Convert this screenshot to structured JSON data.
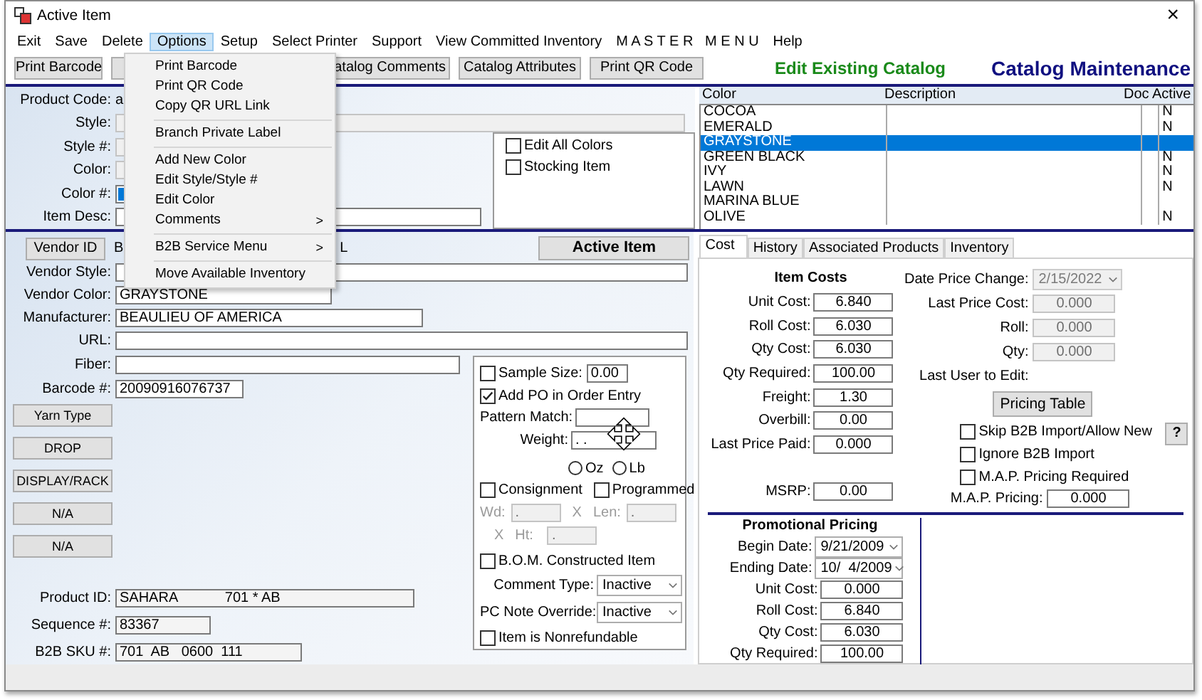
{
  "window": {
    "title": "Active Item",
    "close": "×"
  },
  "menu_bar": [
    {
      "label": "Exit",
      "open": false
    },
    {
      "label": "Save",
      "open": false
    },
    {
      "label": "Delete",
      "open": false
    },
    {
      "label": "Options",
      "open": true
    },
    {
      "label": "Setup",
      "open": false
    },
    {
      "label": "Select Printer",
      "open": false
    },
    {
      "label": "Support",
      "open": false
    },
    {
      "label": "View Committed Inventory",
      "open": false
    },
    {
      "label": "M A S T E R   M E N U",
      "open": false
    },
    {
      "label": "Help",
      "open": false
    }
  ],
  "options_menu": [
    {
      "kind": "item",
      "label": "Print Barcode"
    },
    {
      "kind": "item",
      "label": "Print QR Code"
    },
    {
      "kind": "item",
      "label": "Copy QR URL Link"
    },
    {
      "kind": "separator"
    },
    {
      "kind": "item",
      "label": "Branch Private Label"
    },
    {
      "kind": "separator"
    },
    {
      "kind": "item",
      "label": "Add New Color"
    },
    {
      "kind": "item",
      "label": "Edit Style/Style #"
    },
    {
      "kind": "item",
      "label": "Edit Color"
    },
    {
      "kind": "submenu",
      "label": "Comments",
      "arrow": ">"
    },
    {
      "kind": "separator"
    },
    {
      "kind": "submenu",
      "label": "B2B Service Menu",
      "arrow": ">"
    },
    {
      "kind": "separator"
    },
    {
      "kind": "item",
      "label": "Move Available Inventory"
    }
  ],
  "toolbar": {
    "buttons": [
      {
        "kind": "button",
        "label": "Print Barcode"
      },
      {
        "kind": "blank"
      },
      {
        "kind": "button",
        "label": "atalog Comments"
      },
      {
        "kind": "button",
        "label": "Catalog Attributes"
      },
      {
        "kind": "button",
        "label": "Print QR Code"
      }
    ],
    "mode": "Edit Existing Catalog",
    "heading": "Catalog Maintenance"
  },
  "item_form": {
    "product_code": {
      "label": "Product Code:",
      "value": "a"
    },
    "style": {
      "label": "Style:",
      "disabled": true
    },
    "style_number": {
      "label": "Style #:",
      "disabled": true
    },
    "color": {
      "label": "Color:",
      "disabled": true
    },
    "color_number": {
      "label": "Color #:",
      "highlighted": true
    },
    "item_desc": {
      "label": "Item Desc:"
    },
    "checkboxes": [
      {
        "label": "Edit All Colors",
        "checked": false
      },
      {
        "label": "Stocking Item",
        "checked": false
      }
    ]
  },
  "color_list": {
    "columns": [
      "Color",
      "Description",
      "Doc",
      "Active"
    ],
    "rows": [
      {
        "name": "COCOA",
        "active": "N",
        "selected": false
      },
      {
        "name": "EMERALD",
        "active": "N",
        "selected": false
      },
      {
        "name": "GRAYSTONE",
        "selected": true
      },
      {
        "name": "GREEN BLACK",
        "active": "N",
        "selected": false
      },
      {
        "name": "IVY",
        "active": "N",
        "selected": false
      },
      {
        "name": "LAWN",
        "active": "N",
        "selected": false
      },
      {
        "name": "MARINA BLUE",
        "selected": false
      },
      {
        "name": "OLIVE",
        "active": "N",
        "selected": false
      }
    ]
  },
  "vendor": {
    "button": "Vendor ID",
    "value": "B",
    "trailing": "L",
    "status_button": "Active Item",
    "fields": [
      {
        "label": "Vendor Style:"
      },
      {
        "label": "Vendor Color:",
        "value": "GRAYSTONE"
      },
      {
        "label": "Manufacturer:",
        "value": "BEAULIEU OF AMERICA"
      },
      {
        "label": "URL:"
      }
    ],
    "lower_fields": [
      {
        "label": "Fiber:"
      },
      {
        "label": "Barcode #:",
        "value": "20090916076737"
      }
    ],
    "side_buttons": [
      "Yarn Type",
      "DROP",
      "DISPLAY/RACK",
      "N/A",
      "N/A"
    ],
    "ids": [
      {
        "label": "Product ID:",
        "value": "SAHARA            701 * AB"
      },
      {
        "label": "Sequence #:",
        "value": "83367"
      },
      {
        "label": "B2B SKU #:",
        "value": "701  AB   0600  111"
      }
    ]
  },
  "options": {
    "sample_size": {
      "label": "Sample Size:",
      "checked": false,
      "value": "0.00"
    },
    "add_po": {
      "label": "Add PO in Order Entry",
      "checked": true
    },
    "pattern_match": {
      "label": "Pattern Match:"
    },
    "weight": {
      "label": "Weight:",
      "value": ". ."
    },
    "units": [
      {
        "label": "Oz",
        "selected": false
      },
      {
        "label": "Lb",
        "selected": false
      }
    ],
    "flags": [
      {
        "label": "Consignment",
        "checked": false
      },
      {
        "label": "Programmed",
        "checked": false
      }
    ],
    "dimensions": {
      "disabled": true,
      "width_label": "Wd:",
      "width_value": ".",
      "x1": "X",
      "length_label": "Len:",
      "length_value": ".",
      "x2": "X",
      "height_label": "Ht:",
      "height_value": "."
    },
    "bom": {
      "label": "B.O.M. Constructed Item",
      "checked": false
    },
    "selects": [
      {
        "label": "Comment Type:",
        "value": "Inactive"
      },
      {
        "label": "PC Note Override:",
        "value": "Inactive"
      }
    ],
    "nonrefundable": {
      "label": "Item is Nonrefundable",
      "checked": false
    }
  },
  "tabs": [
    {
      "label": "Cost",
      "selected": true
    },
    {
      "label": "History",
      "selected": false
    },
    {
      "label": "Associated Products",
      "selected": false
    },
    {
      "label": "Inventory",
      "selected": false
    }
  ],
  "cost": {
    "title": "Item Costs",
    "rows": [
      {
        "label": "Unit Cost:",
        "value": "6.840"
      },
      {
        "label": "Roll Cost:",
        "value": "6.030"
      },
      {
        "label": "Qty Cost:",
        "value": "6.030"
      },
      {
        "label": "Qty Required:",
        "value": "100.00"
      },
      {
        "label": "Freight:",
        "value": "1.30"
      },
      {
        "label": "Overbill:",
        "value": "0.00"
      },
      {
        "label": "Last Price Paid:",
        "value": "0.000"
      }
    ],
    "msrp": {
      "label": "MSRP:",
      "value": "0.00"
    },
    "date_price_change": {
      "label": "Date Price Change:",
      "value": "2/15/2022",
      "disabled": true
    },
    "last_prices": [
      {
        "label": "Last Price Cost:",
        "value": "0.000"
      },
      {
        "label": "Roll:",
        "value": "0.000"
      },
      {
        "label": "Qty:",
        "value": "0.000"
      }
    ],
    "last_user": "Last User to Edit:",
    "pricing_button": "Pricing Table",
    "checkboxes": [
      {
        "label": "Skip B2B Import/Allow New",
        "checked": false
      },
      {
        "label": "Ignore B2B Import",
        "checked": false
      },
      {
        "label": "M.A.P. Pricing Required",
        "checked": false
      }
    ],
    "help_button": "?",
    "map_pricing": {
      "label": "M.A.P. Pricing:",
      "value": "0.000"
    }
  },
  "promo": {
    "title": "Promotional Pricing",
    "dates": [
      {
        "label": "Begin Date:",
        "value": "9/21/2009"
      },
      {
        "label": "Ending Date:",
        "value": "10/  4/2009"
      }
    ],
    "rows": [
      {
        "label": "Unit Cost:",
        "value": "0.000"
      },
      {
        "label": "Roll Cost:",
        "value": "6.840"
      },
      {
        "label": "Qty Cost:",
        "value": "6.030"
      },
      {
        "label": "Qty Required:",
        "value": "100.00"
      }
    ]
  }
}
